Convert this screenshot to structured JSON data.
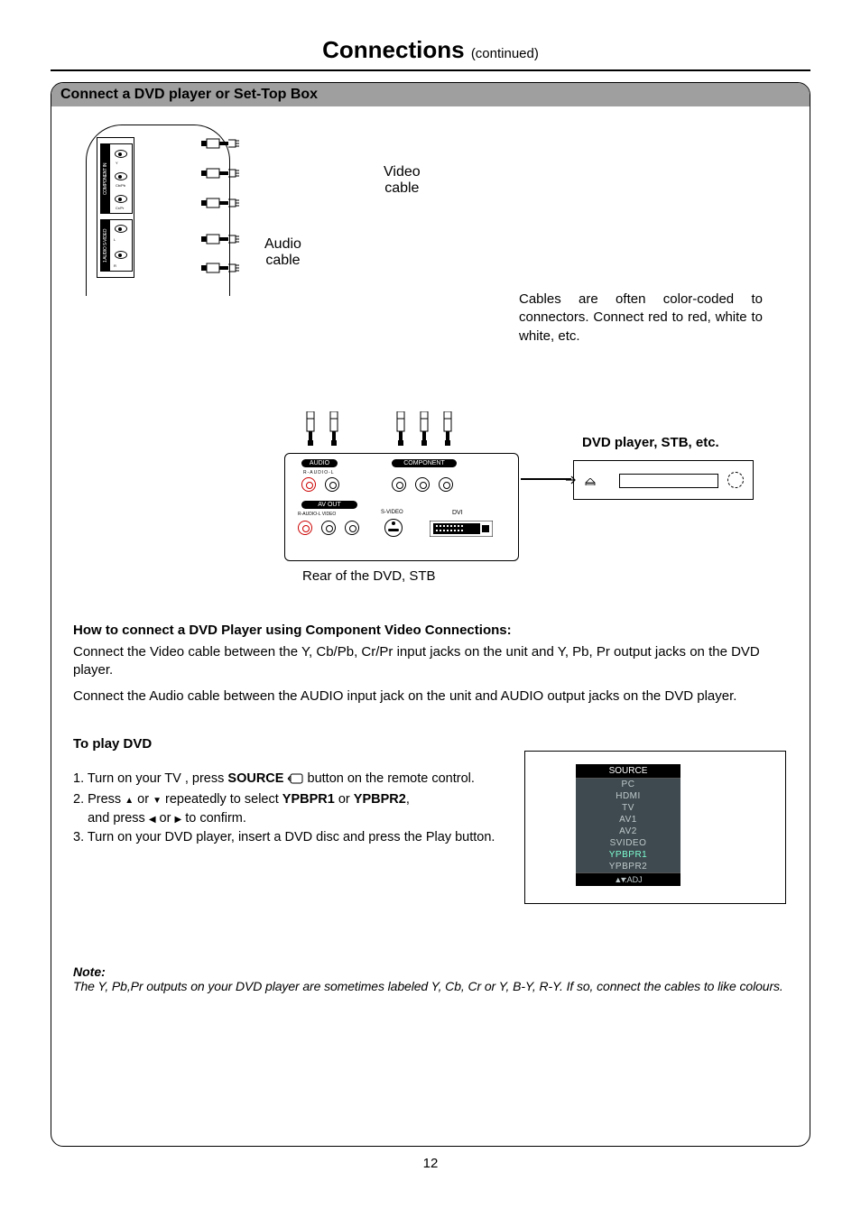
{
  "page": {
    "title_main": "Connections",
    "title_cont": "(continued)",
    "number": "12"
  },
  "section_bar": "Connect a DVD player or Set-Top Box",
  "diagram": {
    "audio_label_l1": "Audio",
    "audio_label_l2": "cable",
    "video_label_l1": "Video",
    "video_label_l2": "cable",
    "cable_note": "Cables are often color-coded to connectors. Connect red to red, white to white, etc.",
    "dvd_label": "DVD player, STB, etc.",
    "rear_caption": "Rear of the DVD, STB",
    "unit": {
      "group_comp": "COMPONENT IN",
      "group_audio": "1 AUDIO S-VIDEO",
      "y": "Y",
      "cb": "Cb/Pb",
      "cr": "Cr/Pr",
      "l": "L",
      "r": "R"
    },
    "rear": {
      "audio": "AUDIO",
      "audio_sub": "R-AUDIO-L",
      "component": "COMPONENT",
      "avout": "AV OUT",
      "avout_sub": "R-AUDIO-L      VIDEO",
      "svideo": "S-VIDEO",
      "dvi": "DVI"
    }
  },
  "howto": {
    "heading": "How to connect a DVD Player using Component Video Connections:",
    "line1": "Connect the Video cable between the Y, Cb/Pb, Cr/Pr input jacks on the unit and Y, Pb, Pr output jacks on the DVD player.",
    "line2": "Connect the Audio cable between  the AUDIO  input jack on the unit and AUDIO output jacks on the DVD player."
  },
  "play": {
    "heading": "To play DVD",
    "s1a": "1. Turn on your TV , press ",
    "s1b": "SOURCE",
    "s1c": " button on the remote control.",
    "s2a": "2. Press ",
    "s2b": " or ",
    "s2c": " repeatedly to select ",
    "s2d": "YPBPR1",
    "s2e": " or ",
    "s2f": "YPBPR2",
    "s2g": ",",
    "s2h": "    and press ",
    "s2i": " or ",
    "s2j": "  to confirm.",
    "s3": "3. Turn on your DVD player, insert a DVD disc and press the Play button."
  },
  "osd": {
    "header": "SOURCE",
    "items": [
      "PC",
      "HDMI",
      "TV",
      "AV1",
      "AV2",
      "SVIDEO",
      "YPBPR1",
      "YPBPR2"
    ],
    "selected_index": 6,
    "footer": ":ADJ"
  },
  "note": {
    "heading": "Note:",
    "body": "The Y, Pb,Pr outputs on your DVD player are sometimes labeled Y, Cb, Cr  or Y, B-Y, R-Y. If so, connect the cables to like colours."
  }
}
